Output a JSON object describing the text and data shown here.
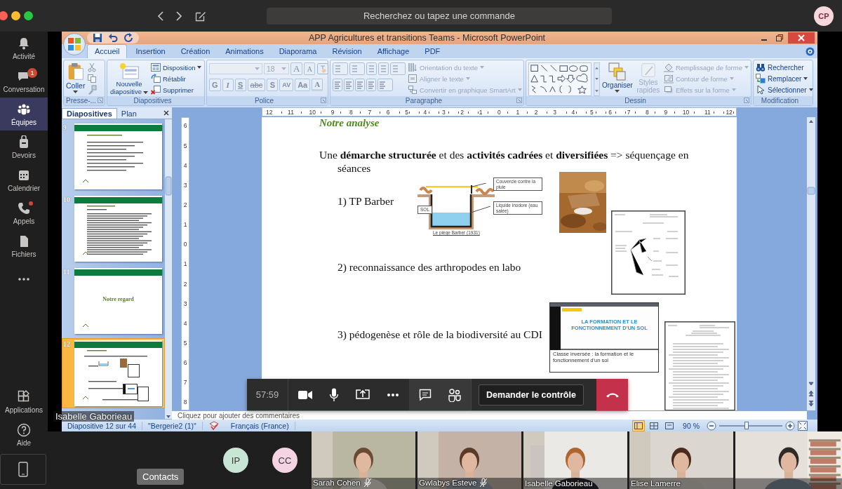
{
  "top_bar": {
    "search": {
      "placeholder": "Recherchez ou tapez une commande"
    },
    "avatar": "CP"
  },
  "rail": {
    "items": [
      {
        "label": "Activité",
        "kind": "bell",
        "selected": false,
        "alert": false
      },
      {
        "label": "Conversation",
        "kind": "chat",
        "selected": false,
        "badge": "1",
        "alert": false
      },
      {
        "label": "Équipes",
        "kind": "teams",
        "selected": true,
        "alert": false
      },
      {
        "label": "Devoirs",
        "kind": "bag",
        "selected": false,
        "alert": false
      },
      {
        "label": "Calendrier",
        "kind": "calendar",
        "selected": false,
        "alert": false
      },
      {
        "label": "Appels",
        "kind": "phone",
        "selected": false,
        "alert": true
      },
      {
        "label": "Fichiers",
        "kind": "file",
        "selected": false,
        "alert": false
      },
      {
        "kind": "more",
        "selected": false,
        "alert": false
      }
    ],
    "bottom": [
      {
        "label": "Applications",
        "kind": "apps"
      },
      {
        "label": "Aide",
        "kind": "help"
      }
    ]
  },
  "ppt": {
    "title": "APP Agricultures et transitions Teams - Microsoft PowerPoint",
    "tabs": [
      {
        "label": "Accueil",
        "selected": true
      },
      {
        "label": "Insertion",
        "selected": false
      },
      {
        "label": "Création",
        "selected": false
      },
      {
        "label": "Animations",
        "selected": false
      },
      {
        "label": "Diaporama",
        "selected": false
      },
      {
        "label": "Révision",
        "selected": false
      },
      {
        "label": "Affichage",
        "selected": false
      },
      {
        "label": "PDF",
        "selected": false
      }
    ],
    "ribbon": [
      {
        "kind": "clipboard",
        "label": "Presse-...",
        "large": "Coller"
      },
      {
        "kind": "slides",
        "label": "Diapositives",
        "large": "Nouvelle diapositive",
        "items": [
          {
            "label": "Disposition",
            "dropdown": true,
            "disabled": false
          },
          {
            "label": "Rétablir",
            "dropdown": false,
            "disabled": false
          },
          {
            "label": "Supprimer",
            "dropdown": false,
            "disabled": false
          }
        ]
      },
      {
        "kind": "font",
        "label": "Police",
        "size": "18",
        "disabled": true,
        "size_buttons": [
          "A",
          "A"
        ],
        "format_buttons": [
          "G",
          "I",
          "S",
          "abc",
          "S",
          "AV",
          "Aa"
        ],
        "color_button": "A"
      },
      {
        "kind": "paragraph",
        "label": "Paragraphe",
        "items": [
          {
            "label": "Orientation du texte",
            "dropdown": true,
            "disabled": true
          },
          {
            "label": "Aligner le texte",
            "dropdown": true,
            "disabled": true
          },
          {
            "label": "Convertir en graphique SmartArt",
            "dropdown": true,
            "disabled": true
          }
        ]
      },
      {
        "kind": "drawing",
        "label": "Dessin",
        "large": "Organiser",
        "large2": "Styles rapides",
        "large2_disabled": true,
        "items": [
          {
            "label": "Remplissage de forme",
            "dropdown": true,
            "disabled": true
          },
          {
            "label": "Contour de forme",
            "dropdown": true,
            "disabled": true
          },
          {
            "label": "Effets sur la forme",
            "dropdown": true,
            "disabled": true
          }
        ]
      },
      {
        "kind": "editing",
        "label": "Modification",
        "items": [
          {
            "label": "Rechercher",
            "dropdown": false,
            "disabled": false
          },
          {
            "label": "Remplacer",
            "dropdown": true,
            "disabled": false
          },
          {
            "label": "Sélectionner",
            "dropdown": true,
            "disabled": false
          }
        ]
      }
    ],
    "panel_tabs": [
      {
        "label": "Diapositives",
        "selected": true
      },
      {
        "label": "Plan",
        "selected": false
      }
    ],
    "thumbnails": [
      {
        "number": "9",
        "kind": "text",
        "selected": false
      },
      {
        "number": "10",
        "kind": "dense",
        "selected": false
      },
      {
        "number": "11",
        "kind": "title",
        "title": "Notre regard",
        "selected": false
      },
      {
        "number": "12",
        "kind": "figures",
        "selected": true
      }
    ],
    "ruler_h": [
      "12",
      "11",
      "10",
      "9",
      "8",
      "7",
      "6",
      "5",
      "4",
      "3",
      "2",
      "1",
      "0",
      "1",
      "2",
      "3",
      "4",
      "5",
      "6",
      "7",
      "8",
      "9",
      "10",
      "11",
      "12"
    ],
    "ruler_v": [
      "6",
      "5",
      "4",
      "3",
      "2",
      "1",
      "0",
      "1",
      "2",
      "3",
      "4",
      "5",
      "6",
      "7",
      "8"
    ],
    "slide": {
      "title": "Notre analyse",
      "intro": "Une **démarche structurée** et des **activités cadrées**  et **diversifiées** => séquençage en séances",
      "steps": [
        "1) TP Barber",
        "2) reconnaissance des arthropodes en labo",
        "3) pédogenèse et rôle de la biodiversité au CDI"
      ],
      "diagram": {
        "labels": [
          "Couvercle contre la pluie",
          "SOL",
          "Liquide inodore (eau salée)"
        ],
        "caption": "Le piège Barber (1931)"
      },
      "video": {
        "title": "LA FORMATION ET LE FONCTIONNEMENT D'UN SOL",
        "caption": "Classe inversée : la formation et le fonctionnement d'un sol"
      }
    },
    "notes_placeholder": "Cliquez pour ajouter des commentaires",
    "status": {
      "slide": "Diapositive 12 sur 44",
      "theme": "\"Bergerie2 (1)\"",
      "language": "Français (France)",
      "views": [
        {
          "kind": "normal",
          "selected": true
        },
        {
          "kind": "sorter",
          "selected": false
        },
        {
          "kind": "show",
          "selected": false
        }
      ],
      "zoom": "90 %",
      "zoom_slider": {
        "level": 0.43
      }
    }
  },
  "presenter": "Isabelle Gaborieau",
  "meeting": {
    "timer": "57:59",
    "request_control": "Demander le contrôle"
  },
  "participants": [
    {
      "initials": "IP",
      "color": "#c9e6d4"
    },
    {
      "initials": "CC",
      "color": "#f4d4e2"
    }
  ],
  "videos": [
    {
      "name": "Sarah Cohen",
      "muted": true
    },
    {
      "name": "Gwlabys Esteve",
      "muted": true
    },
    {
      "name": "Isabelle Gaborieau",
      "muted": false
    },
    {
      "name": "Elise Lamerre",
      "muted": false
    },
    {
      "muted": false
    }
  ],
  "tooltip": "Contacts"
}
